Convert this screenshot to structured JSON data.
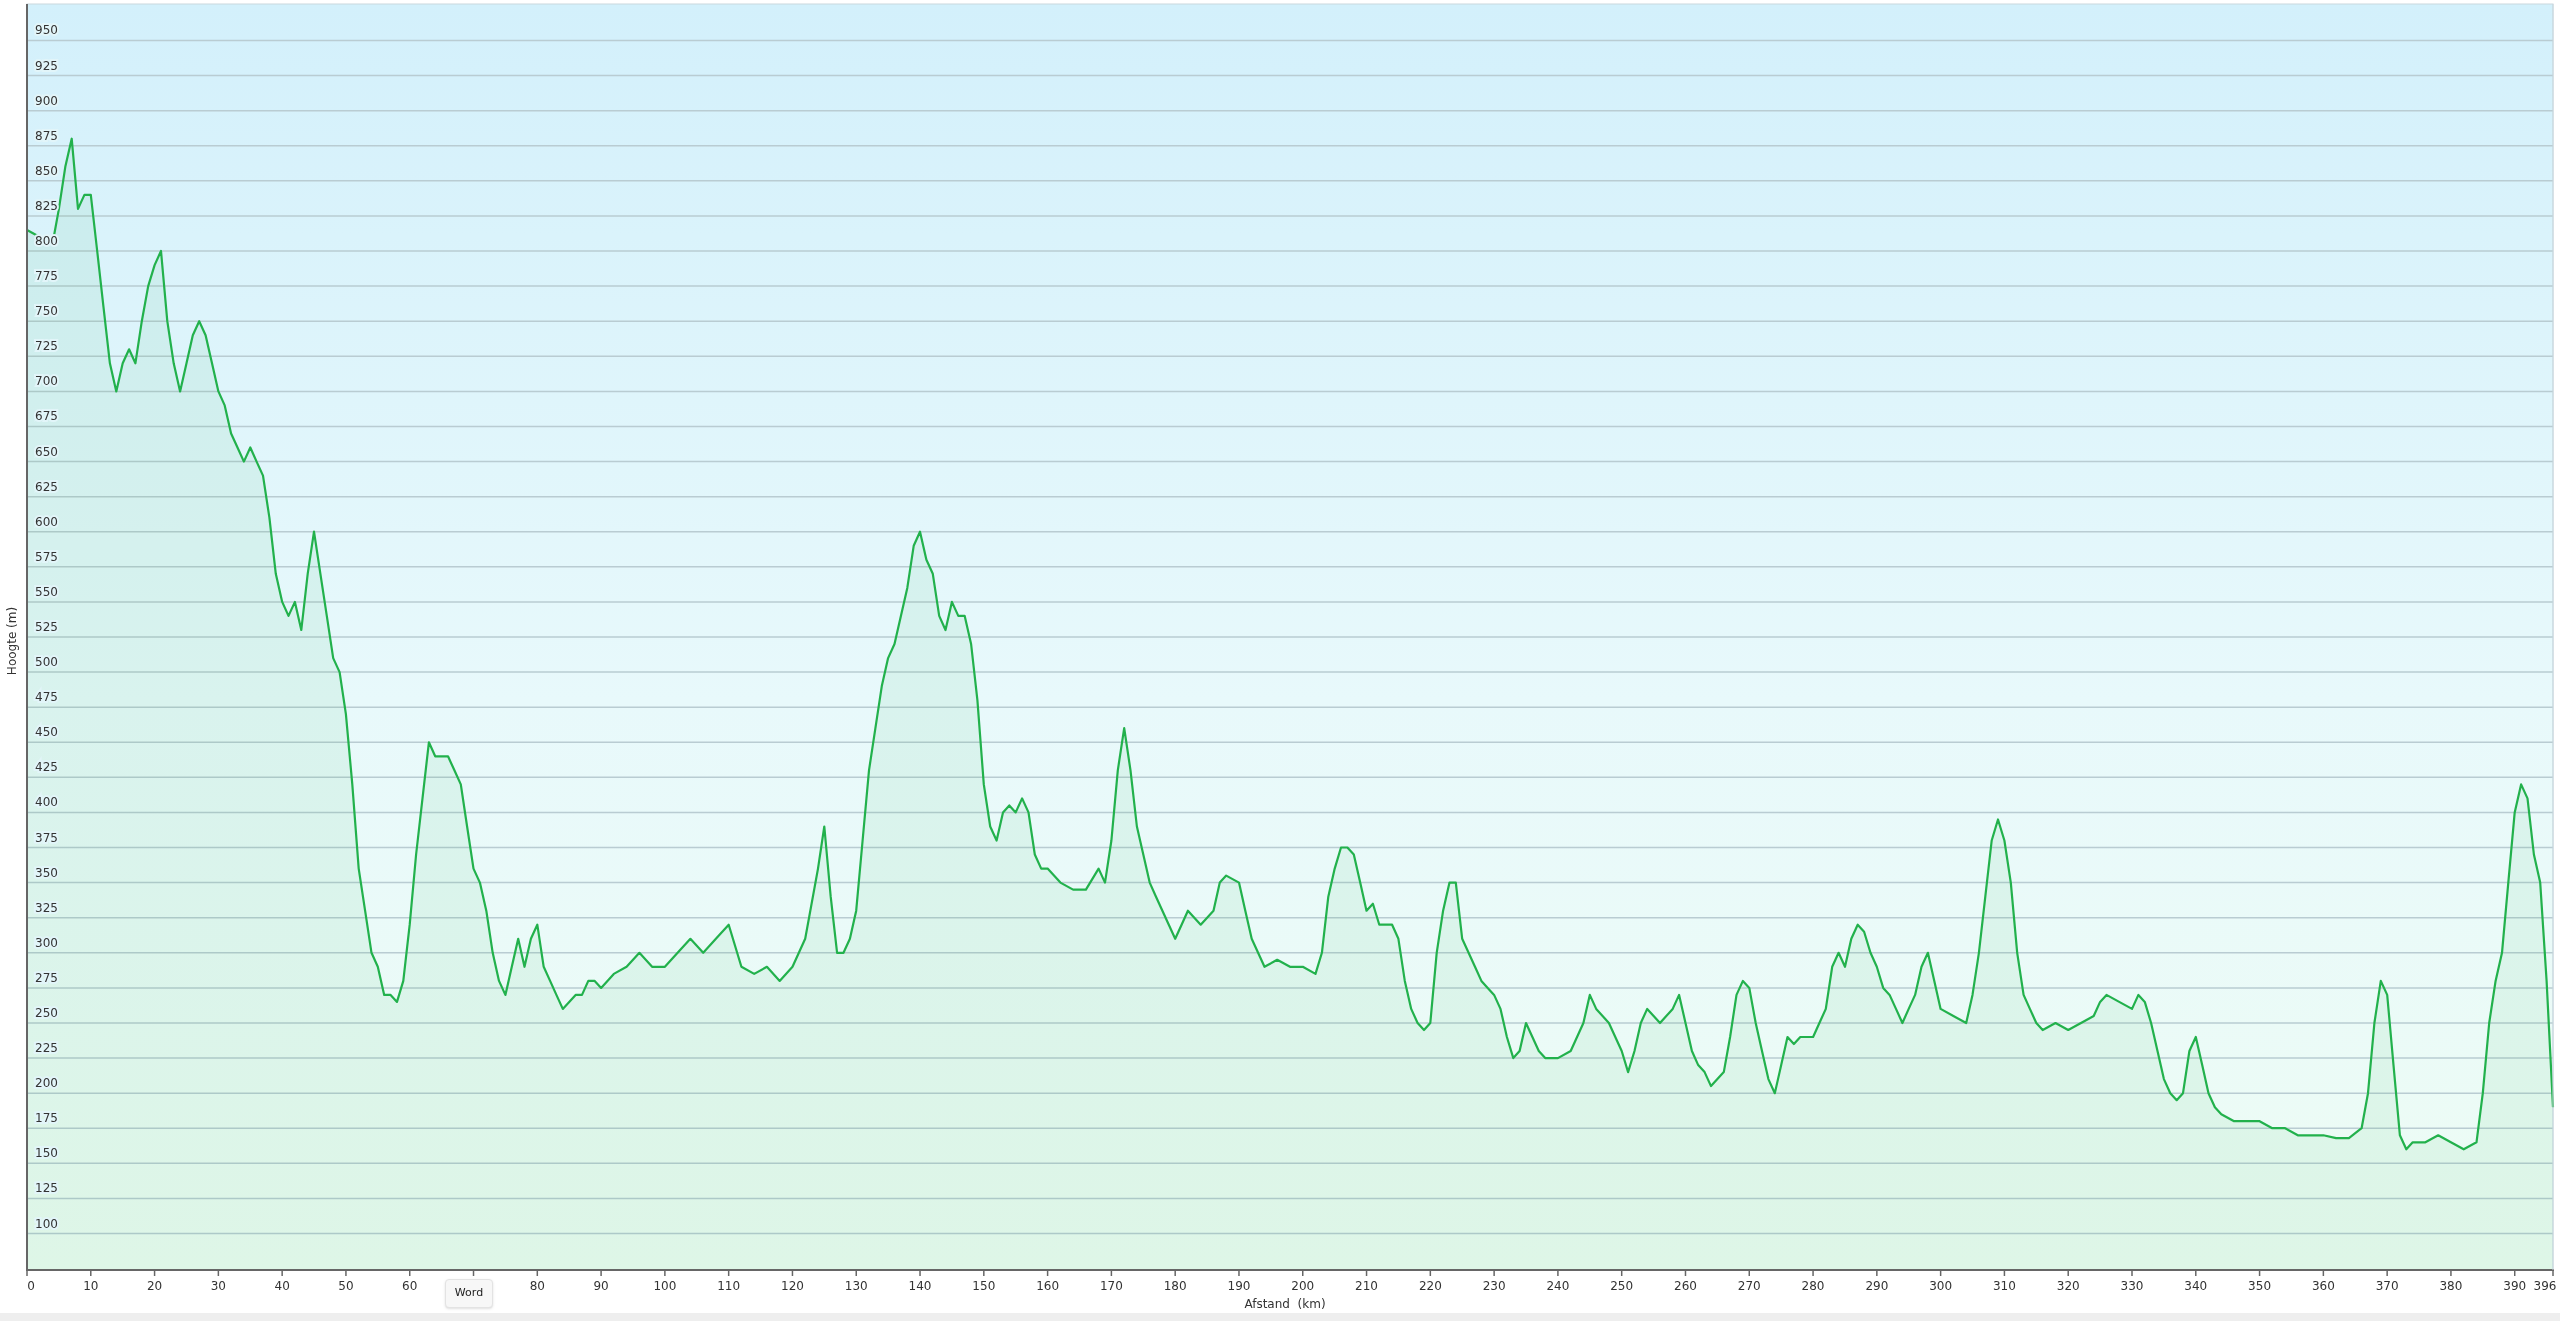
{
  "chart": {
    "chart_data": {
      "type": "area",
      "grid": true,
      "xlabel": "Afstand  (km)",
      "ylabel": "Hoogte (m)",
      "xlim": [
        0,
        396
      ],
      "ylim": [
        74,
        976
      ],
      "xticks": [
        0,
        10,
        20,
        30,
        40,
        50,
        60,
        80,
        90,
        100,
        110,
        120,
        130,
        140,
        150,
        160,
        170,
        180,
        190,
        200,
        210,
        220,
        230,
        240,
        250,
        260,
        270,
        280,
        290,
        300,
        310,
        320,
        330,
        340,
        350,
        360,
        370,
        380,
        390,
        396
      ],
      "yticks": [
        100,
        125,
        150,
        175,
        200,
        225,
        250,
        275,
        300,
        325,
        350,
        375,
        400,
        425,
        450,
        475,
        500,
        525,
        550,
        575,
        600,
        625,
        650,
        675,
        700,
        725,
        750,
        775,
        800,
        825,
        850,
        875,
        900,
        925,
        950
      ],
      "x": [
        0,
        2,
        4,
        5,
        6,
        7,
        8,
        9,
        10,
        11,
        12,
        13,
        14,
        15,
        16,
        17,
        18,
        19,
        20,
        21,
        22,
        23,
        24,
        25,
        26,
        27,
        28,
        29,
        30,
        31,
        32,
        33,
        34,
        35,
        36,
        37,
        38,
        39,
        40,
        41,
        42,
        43,
        44,
        45,
        46,
        47,
        48,
        49,
        50,
        51,
        52,
        53,
        54,
        55,
        56,
        57,
        58,
        59,
        60,
        61,
        62,
        63,
        64,
        65,
        66,
        67,
        68,
        69,
        70,
        71,
        72,
        73,
        74,
        75,
        76,
        77,
        78,
        79,
        80,
        81,
        82,
        83,
        84,
        85,
        86,
        87,
        88,
        89,
        90,
        92,
        94,
        96,
        98,
        100,
        102,
        104,
        106,
        108,
        110,
        112,
        114,
        116,
        118,
        120,
        122,
        124,
        125,
        126,
        127,
        128,
        129,
        130,
        131,
        132,
        133,
        134,
        135,
        136,
        137,
        138,
        139,
        140,
        141,
        142,
        143,
        144,
        145,
        146,
        147,
        148,
        149,
        150,
        151,
        152,
        153,
        154,
        155,
        156,
        157,
        158,
        159,
        160,
        162,
        164,
        166,
        168,
        169,
        170,
        171,
        172,
        173,
        174,
        175,
        176,
        177,
        178,
        179,
        180,
        181,
        182,
        184,
        186,
        187,
        188,
        190,
        191,
        192,
        193,
        194,
        196,
        198,
        200,
        202,
        203,
        204,
        205,
        206,
        207,
        208,
        209,
        210,
        211,
        212,
        213,
        214,
        215,
        216,
        217,
        218,
        219,
        220,
        221,
        222,
        223,
        224,
        225,
        226,
        227,
        228,
        229,
        230,
        231,
        232,
        233,
        234,
        235,
        236,
        237,
        238,
        240,
        242,
        244,
        245,
        246,
        248,
        250,
        251,
        252,
        253,
        254,
        256,
        258,
        259,
        260,
        261,
        262,
        263,
        264,
        265,
        266,
        267,
        268,
        269,
        270,
        271,
        272,
        273,
        274,
        275,
        276,
        277,
        278,
        280,
        281,
        282,
        283,
        284,
        285,
        286,
        287,
        288,
        289,
        290,
        291,
        292,
        293,
        294,
        295,
        296,
        297,
        298,
        299,
        300,
        302,
        304,
        305,
        306,
        307,
        308,
        309,
        310,
        311,
        312,
        313,
        314,
        315,
        316,
        318,
        320,
        322,
        324,
        325,
        326,
        328,
        330,
        331,
        332,
        333,
        334,
        335,
        336,
        337,
        338,
        339,
        340,
        341,
        342,
        343,
        344,
        346,
        348,
        350,
        352,
        354,
        356,
        358,
        360,
        362,
        364,
        366,
        367,
        368,
        369,
        370,
        371,
        372,
        373,
        374,
        376,
        378,
        380,
        382,
        384,
        385,
        386,
        387,
        388,
        389,
        390,
        391,
        392,
        393,
        394,
        395,
        396
      ],
      "series": [
        {
          "color": "#22b14c",
          "values": [
            815,
            810,
            805,
            830,
            860,
            880,
            830,
            840,
            840,
            800,
            760,
            720,
            700,
            720,
            730,
            720,
            750,
            775,
            790,
            800,
            750,
            720,
            700,
            720,
            740,
            750,
            740,
            720,
            700,
            690,
            670,
            660,
            650,
            660,
            650,
            640,
            610,
            570,
            550,
            540,
            550,
            530,
            570,
            600,
            570,
            540,
            510,
            500,
            470,
            420,
            360,
            330,
            300,
            290,
            270,
            270,
            265,
            280,
            320,
            370,
            410,
            450,
            440,
            440,
            440,
            430,
            420,
            390,
            360,
            350,
            330,
            300,
            280,
            270,
            290,
            310,
            290,
            310,
            320,
            290,
            280,
            270,
            260,
            265,
            270,
            270,
            280,
            280,
            275,
            285,
            290,
            300,
            290,
            290,
            300,
            310,
            300,
            310,
            320,
            290,
            285,
            290,
            280,
            290,
            310,
            360,
            390,
            340,
            300,
            300,
            310,
            330,
            380,
            430,
            460,
            490,
            510,
            520,
            540,
            560,
            590,
            600,
            580,
            570,
            540,
            530,
            550,
            540,
            540,
            520,
            480,
            420,
            390,
            380,
            400,
            405,
            400,
            410,
            400,
            370,
            360,
            360,
            350,
            345,
            345,
            360,
            350,
            380,
            430,
            460,
            430,
            390,
            370,
            350,
            340,
            330,
            320,
            310,
            320,
            330,
            320,
            330,
            350,
            355,
            350,
            330,
            310,
            300,
            290,
            295,
            290,
            290,
            285,
            300,
            340,
            360,
            375,
            375,
            370,
            350,
            330,
            335,
            320,
            320,
            320,
            310,
            280,
            260,
            250,
            245,
            250,
            300,
            330,
            350,
            350,
            310,
            300,
            290,
            280,
            275,
            270,
            260,
            240,
            225,
            230,
            250,
            240,
            230,
            225,
            225,
            230,
            250,
            270,
            260,
            250,
            230,
            215,
            230,
            250,
            260,
            250,
            260,
            270,
            250,
            230,
            220,
            215,
            205,
            210,
            215,
            240,
            270,
            280,
            275,
            250,
            230,
            210,
            200,
            220,
            240,
            235,
            240,
            240,
            250,
            260,
            290,
            300,
            290,
            310,
            320,
            315,
            300,
            290,
            275,
            270,
            260,
            250,
            260,
            270,
            290,
            300,
            280,
            260,
            255,
            250,
            270,
            300,
            340,
            380,
            395,
            380,
            350,
            300,
            270,
            260,
            250,
            245,
            250,
            245,
            250,
            255,
            265,
            270,
            265,
            260,
            270,
            265,
            250,
            230,
            210,
            200,
            195,
            200,
            230,
            240,
            220,
            200,
            190,
            185,
            180,
            180,
            180,
            175,
            175,
            170,
            170,
            170,
            168,
            168,
            175,
            200,
            250,
            280,
            270,
            220,
            170,
            160,
            165,
            165,
            170,
            165,
            160,
            165,
            200,
            250,
            280,
            300,
            350,
            400,
            420,
            410,
            370,
            350,
            280,
            190
          ]
        }
      ]
    }
  },
  "button": {
    "label": "Word"
  }
}
